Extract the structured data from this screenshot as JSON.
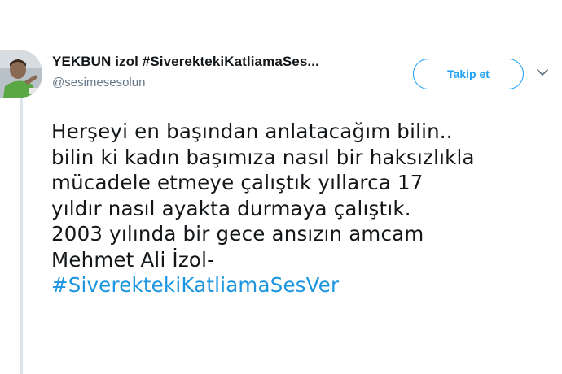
{
  "author": {
    "display_name": "YEKBUN izol #SiverektekiKatliamaSes...",
    "handle": "@sesimesesolun",
    "avatar_icon": "profile-photo"
  },
  "follow_button": {
    "label": "Takip et"
  },
  "menu_icon": "chevron-down-icon",
  "tweet": {
    "lines": [
      "Herşeyi en başından anlatacağım bilin..",
      "bilin ki kadın başımıza nasıl bir haksızlıkla",
      "mücadele etmeye çalıştık yıllarca  17",
      "yıldır nasıl ayakta durmaya çalıştık.",
      "2003 yılında bir gece ansızın amcam",
      "Mehmet Ali İzol-"
    ],
    "hashtag": "#SiverektekiKatliamaSesVer"
  },
  "colors": {
    "accent": "#1da1f2",
    "hashtag": "#1b95e0",
    "text": "#14171a",
    "secondary_text": "#657786",
    "thread_line": "#d9e4ec"
  }
}
